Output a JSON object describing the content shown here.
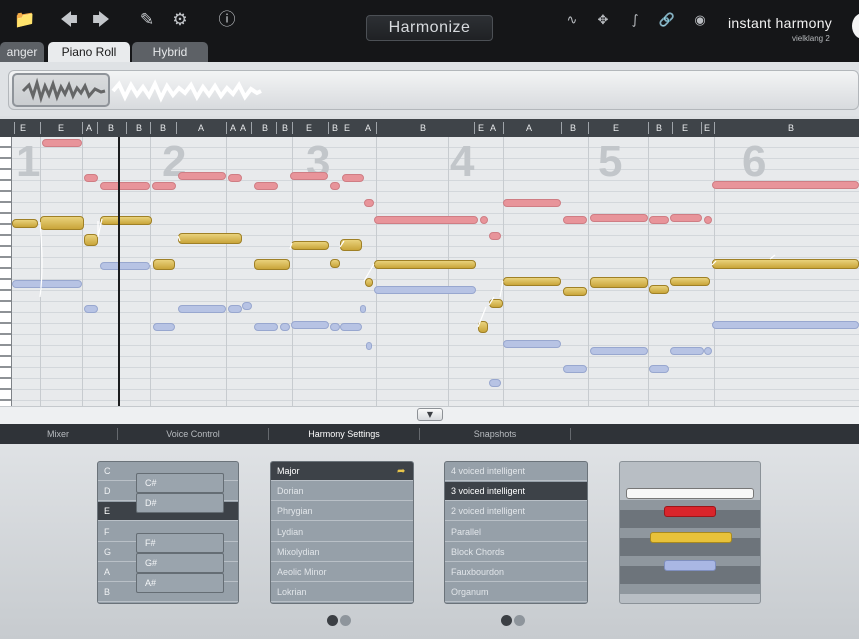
{
  "toolbar": {
    "icons": [
      "folder-icon",
      "arrow-left-icon",
      "arrow-right-icon",
      "edit-icon",
      "gear-icon",
      "help-icon"
    ],
    "harmonize_label": "Harmonize",
    "right_icons": [
      "waveform-icon",
      "crosshair-icon",
      "split-icon",
      "link-icon",
      "record-icon"
    ]
  },
  "brand": {
    "name": "instant harmony",
    "subtitle": "vielklang 2"
  },
  "tabs": [
    {
      "label": "anger",
      "active": false
    },
    {
      "label": "Piano Roll",
      "active": true
    },
    {
      "label": "Hybrid",
      "active": false
    }
  ],
  "chords": [
    "E",
    "E",
    "A",
    "B",
    "B",
    "B",
    "A",
    "A",
    "A",
    "B",
    "B",
    "E",
    "B",
    "E",
    "A",
    "B",
    "E",
    "A",
    "A",
    "B",
    "E",
    "B",
    "E",
    "E",
    "B"
  ],
  "bar_numbers": [
    "1",
    "2",
    "3",
    "4",
    "5",
    "6"
  ],
  "lower_tabs": [
    {
      "label": "Mixer",
      "active": false
    },
    {
      "label": "Voice Control",
      "active": false
    },
    {
      "label": "Harmony Settings",
      "active": true
    },
    {
      "label": "Snapshots",
      "active": false
    }
  ],
  "key_list": {
    "naturals": [
      "C",
      "D",
      "E",
      "F",
      "G",
      "A",
      "B"
    ],
    "selected": "E",
    "sharps": [
      "C#",
      "D#",
      "F#",
      "G#",
      "A#"
    ]
  },
  "scale_list": {
    "items": [
      "Major",
      "Dorian",
      "Phrygian",
      "Lydian",
      "Mixolydian",
      "Aeolic Minor",
      "Lokrian"
    ],
    "selected": "Major"
  },
  "voicing_list": {
    "items": [
      "4 voiced intelligent",
      "3 voiced intelligent",
      "2 voiced intelligent",
      "Parallel",
      "Block Chords",
      "Fauxbourdon",
      "Organum"
    ],
    "selected": "3 voiced intelligent"
  },
  "colors": {
    "melody": "#d4b04a",
    "voice1": "#e8949a",
    "voice2": "#b7c3e4",
    "voice3_slider": "#d9252b"
  }
}
